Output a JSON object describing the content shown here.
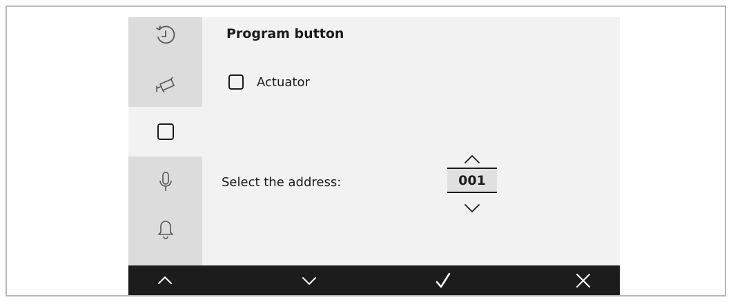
{
  "colors": {
    "screen_background": "#f2f2f2",
    "sidebar_background": "#dcdcdc",
    "bottom_bar_background": "#1c1c1c",
    "icon_color": "#ffffff",
    "text_color": "#1a1a1a"
  },
  "sidebar": {
    "items": [
      {
        "icon": "history-icon",
        "active": false
      },
      {
        "icon": "camera-icon",
        "active": false
      },
      {
        "icon": "square-icon",
        "active": true
      },
      {
        "icon": "microphone-icon",
        "active": false
      },
      {
        "icon": "bell-icon",
        "active": false
      }
    ]
  },
  "main": {
    "title": "Program button",
    "checkbox": {
      "label": "Actuator",
      "checked": false
    },
    "address": {
      "label": "Select the address:",
      "value": "001"
    }
  },
  "bottom_bar": {
    "buttons": [
      {
        "icon": "chevron-up-icon"
      },
      {
        "icon": "chevron-down-icon"
      },
      {
        "icon": "checkmark-icon"
      },
      {
        "icon": "close-icon"
      }
    ]
  }
}
